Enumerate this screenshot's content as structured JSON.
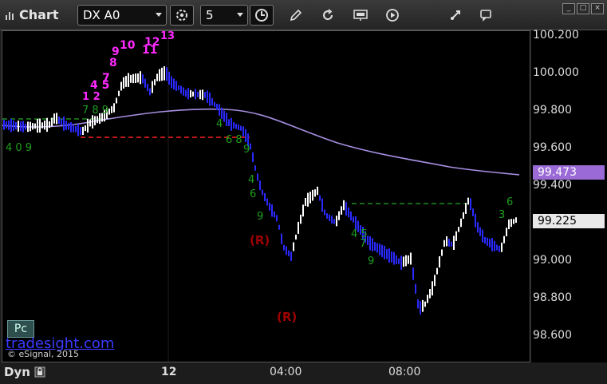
{
  "window": {
    "title": "Chart"
  },
  "toolbar": {
    "symbol": "DX A0",
    "interval": "5",
    "icons": [
      "settings-gear-icon",
      "clock-icon",
      "pencil-icon",
      "refresh-icon",
      "study-icon",
      "play-icon",
      "cursor-icon",
      "comment-icon"
    ]
  },
  "price_axis": {
    "labels": [
      "100.200",
      "100.000",
      "99.800",
      "99.600",
      "99.400",
      "99.200",
      "99.000",
      "98.800",
      "98.600"
    ],
    "tags": [
      {
        "text": "99.473",
        "color": "#9a6bd6",
        "text_color": "#ffffff"
      },
      {
        "text": "99.225",
        "color": "#e8e8e8",
        "text_color": "#000000"
      }
    ]
  },
  "time_axis": {
    "labels": [
      "12",
      "04:00",
      "08:00"
    ]
  },
  "footer": {
    "dyn_label": "Dyn"
  },
  "overlay": {
    "pc_button": "Pc",
    "watermark_link": "tradesight.com",
    "copyright": "© eSignal, 2015"
  },
  "chart_annotations": {
    "magenta_counts": [
      "1",
      "2",
      "3",
      "4",
      "5",
      "6",
      "7",
      "8",
      "9",
      "10",
      "11",
      "12",
      "13"
    ],
    "green_counts_left": "4 0 9",
    "red_markers": [
      "(R)",
      "(R)"
    ]
  },
  "colors": {
    "up_bar": "#ffffff",
    "down_bar": "#2a2aff",
    "ma_line": "#a58ee0",
    "red_level": "#ff2020",
    "green_level": "#1e8a1e",
    "magenta": "#ff2aff",
    "green_digits": "#1fa01f",
    "marker_red": "#a00000"
  }
}
